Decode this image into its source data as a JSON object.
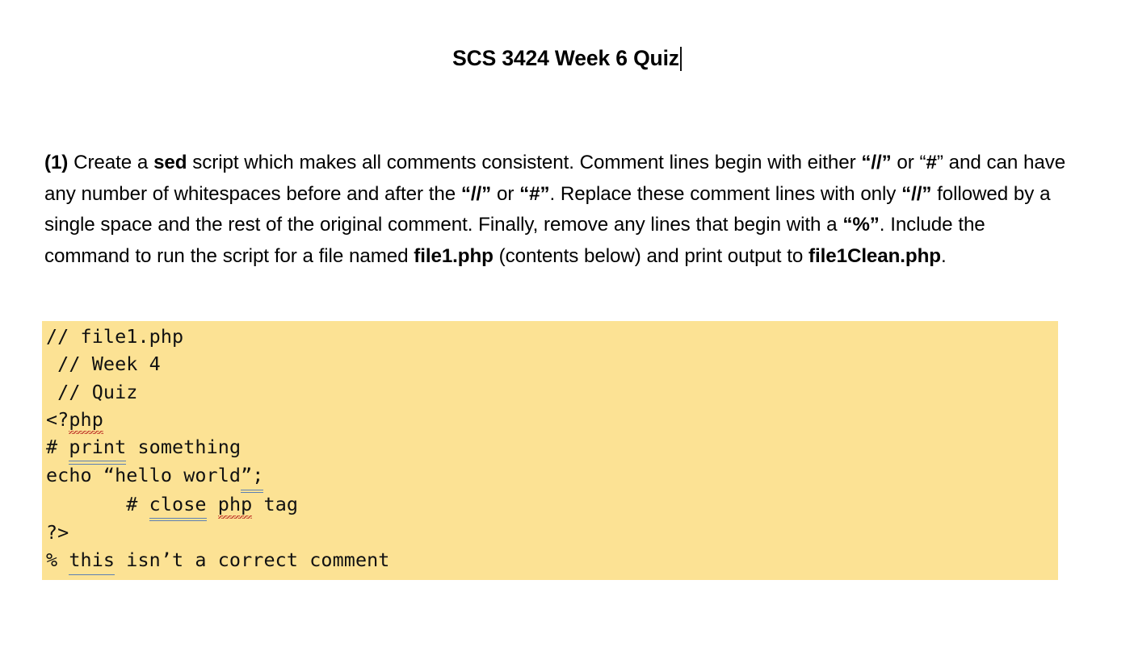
{
  "document": {
    "title": "SCS 3424 Week 6 Quiz",
    "caret_after_title": true,
    "background_color": "#ffffff",
    "text_color": "#000000"
  },
  "question": {
    "number_label": "(1)",
    "segments": [
      {
        "text": "(1)",
        "bold": true
      },
      {
        "text": " Create a ",
        "bold": false
      },
      {
        "text": "sed",
        "bold": true
      },
      {
        "text": " script which makes all comments consistent.",
        "bold": false
      },
      {
        "text": " Comment lines begin with either ",
        "bold": false
      },
      {
        "text": "“//”",
        "bold": true
      },
      {
        "text": " or “",
        "bold": false
      },
      {
        "text": "#",
        "bold": true
      },
      {
        "text": "” and can have any number of whitespaces before and after the ",
        "bold": false
      },
      {
        "text": "“//”",
        "bold": true
      },
      {
        "text": " or ",
        "bold": false
      },
      {
        "text": "“#”",
        "bold": true
      },
      {
        "text": ". Replace these comment lines with only ",
        "bold": false
      },
      {
        "text": "“//”",
        "bold": true
      },
      {
        "text": " followed by a single space and the rest of the original comment.  Finally, remove any lines that begin with a ",
        "bold": false
      },
      {
        "text": "“%”",
        "bold": true
      },
      {
        "text": ". Include the command to run the script for a file named ",
        "bold": false
      },
      {
        "text": "file1.php",
        "bold": true
      },
      {
        "text": " (contents below) and print output to ",
        "bold": false
      },
      {
        "text": "file1Clean.php",
        "bold": true
      },
      {
        "text": ".",
        "bold": false
      }
    ],
    "plain_text": "(1) Create a sed script which makes all comments consistent. Comment lines begin with either “//” or “#” and can have any number of whitespaces before and after the “//” or “#”. Replace these comment lines with only “//” followed by a single space and the rest of the original comment.  Finally, remove any lines that begin with a “%”. Include the command to run the script for a file named file1.php (contents below) and print output to file1Clean.php."
  },
  "code_block": {
    "highlight_color": "#fce294",
    "filename": "file1.php",
    "lines": [
      "// file1.php",
      " // Week 4",
      " // Quiz",
      "<?php",
      "# print something",
      "echo “hello world”;",
      "       # close php tag",
      "?>",
      "% this isn’t a correct comment"
    ],
    "line_parts": {
      "l1": "// file1.php",
      "l2": " // Week 4",
      "l3": " // Quiz",
      "l4_pre": "<?php",
      "l4_a": "<?",
      "l4_misspelled": "php",
      "l5_a": "# ",
      "l5_grammar": "print",
      "l5_b": " something",
      "l6_a": "echo “hello world",
      "l6_grammar": "”;",
      "l7_a": "       # ",
      "l7_grammar": "close",
      "l7_space": " ",
      "l7_misspelled": "php",
      "l7_b": " tag",
      "l8": "?>",
      "l9_a": "% ",
      "l9_underline": "this",
      "l9_b": " isn’t a correct comment"
    }
  },
  "markers": {
    "spellcheck_color": "#c0392b",
    "grammarcheck_color": "#5b7fb4"
  }
}
